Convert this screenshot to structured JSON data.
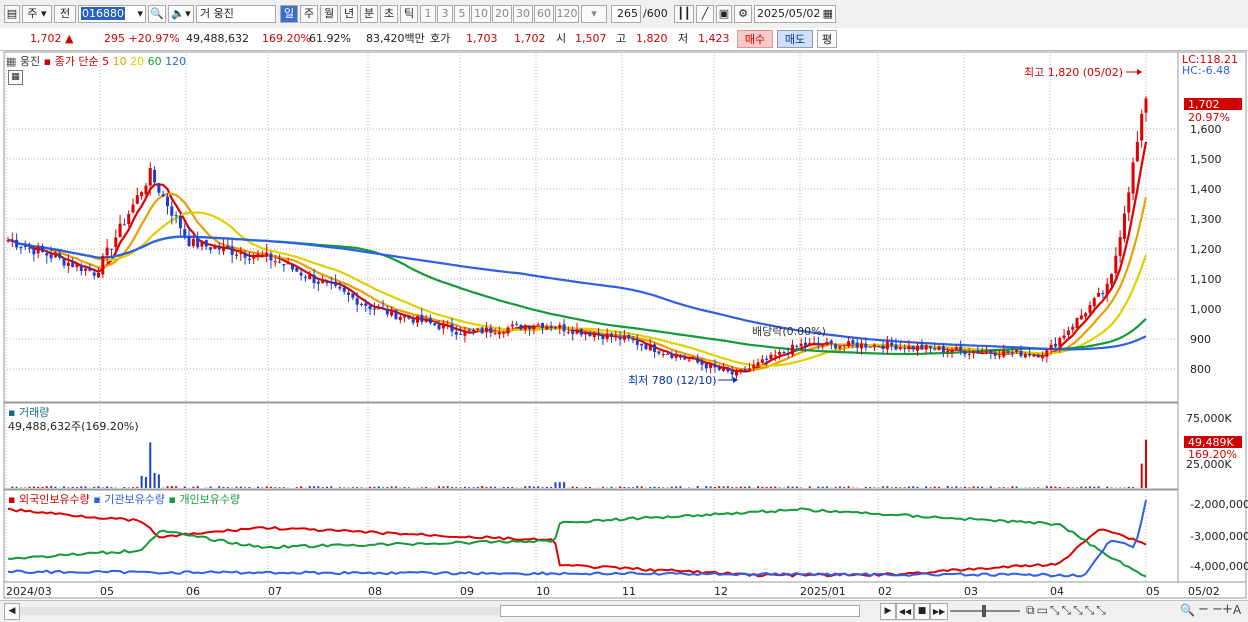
{
  "toolbar": {
    "market_prefix": "주",
    "period_prefix": "전",
    "stock_code": "016880",
    "stock_prefix": "거",
    "stock_name": "웅진",
    "periods": [
      "일",
      "주",
      "월",
      "년",
      "분",
      "초",
      "틱"
    ],
    "active_period": "일",
    "intervals": [
      "1",
      "3",
      "5",
      "10",
      "20",
      "30",
      "60",
      "120"
    ],
    "count": "265",
    "count_total": "/600",
    "date": "2025/05/02"
  },
  "info": {
    "price": "1,702",
    "change_arrow": "▲",
    "change": "295",
    "change_pct": "+20.97%",
    "volume": "49,488,632",
    "volume_ratio": "169.20%",
    "turnover": "61.92%",
    "amount": "83,420백만",
    "bid_label": "호가",
    "ask": "1,703",
    "bid": "1,702",
    "open_label": "시",
    "open": "1,507",
    "high_label": "고",
    "high": "1,820",
    "low_label": "저",
    "low": "1,423",
    "buy_button": "매수",
    "sell_button": "매도",
    "eval_button": "평"
  },
  "legend": {
    "stock_name": "웅진",
    "ma_label": "종가 단순",
    "ma_periods": [
      "5",
      "10",
      "20",
      "60",
      "120"
    ],
    "ma_colors": [
      "#dd0000",
      "#e9a000",
      "#e0d000",
      "#139a39",
      "#2e5fe6"
    ],
    "volume_title": "거래량",
    "volume_value": "49,488,632주(169.20%)",
    "holdings": [
      "외국인보유수량",
      "기관보유수량",
      "개인보유수량"
    ],
    "holding_colors": [
      "#dd0000",
      "#2e5fe6",
      "#139a39"
    ]
  },
  "right_axis": {
    "lc": "LC:118.21",
    "hc": "HC:-6.48",
    "price_ticks": [
      "1,600",
      "1,500",
      "1,400",
      "1,300",
      "1,200",
      "1,100",
      "1,000",
      "900",
      "800"
    ],
    "price_tag": "1,702",
    "pct_tag": "20.97%",
    "volume_ticks": [
      "75,000K",
      "25,000K"
    ],
    "volume_tag": "49,489K",
    "volume_pct_tag": "169.20%",
    "holding_ticks": [
      "-2,000,000",
      "-3,000,000",
      "-4,000,000"
    ]
  },
  "annotations": {
    "high": "최고 1,820 (05/02)",
    "low": "최저 780 (12/10)",
    "dividend": "배당락(0.00%)"
  },
  "x_axis": {
    "labels": [
      "2024/03",
      "05",
      "06",
      "07",
      "08",
      "09",
      "10",
      "11",
      "12",
      "2025/01",
      "02",
      "03",
      "04",
      "05"
    ],
    "end_label": "05/02"
  },
  "chart_data": {
    "type": "candlestick",
    "price_range": [
      730,
      1830
    ],
    "price_anchors": [
      {
        "date": "2024/03",
        "close": 1230
      },
      {
        "date": "05 (early)",
        "close": 1120
      },
      {
        "date": "05 (peak)",
        "close": 1450
      },
      {
        "date": "06",
        "close": 1220
      },
      {
        "date": "07",
        "close": 1170
      },
      {
        "date": "08",
        "close": 1000
      },
      {
        "date": "09",
        "close": 920
      },
      {
        "date": "10",
        "close": 950
      },
      {
        "date": "11",
        "close": 900
      },
      {
        "date": "12/10",
        "close": 780
      },
      {
        "date": "2025/01",
        "close": 880
      },
      {
        "date": "02",
        "close": 880
      },
      {
        "date": "03",
        "close": 860
      },
      {
        "date": "04",
        "close": 850
      },
      {
        "date": "04 (late)",
        "close": 1080
      },
      {
        "date": "05/02",
        "close": 1702
      }
    ],
    "high": {
      "value": 1820,
      "date": "05/02"
    },
    "low": {
      "value": 780,
      "date": "12/10"
    },
    "volume_last": 49489000
  },
  "bottom": {
    "controls": [
      "▶",
      "◀◀",
      "■",
      "▶▶"
    ]
  }
}
